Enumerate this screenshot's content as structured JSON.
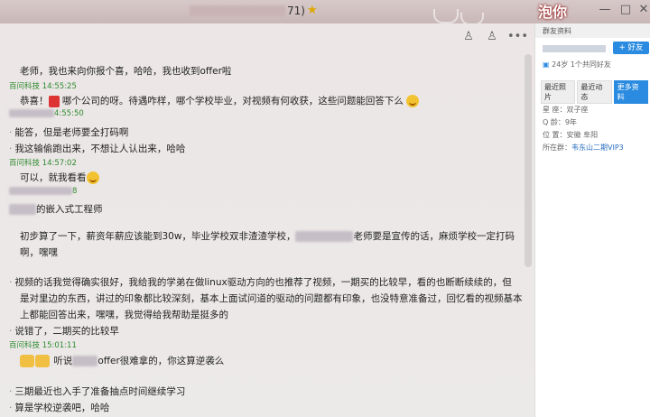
{
  "window": {
    "title_suffix": "71)",
    "logo_text": "泡你",
    "controls": [
      "—",
      "□",
      "✕"
    ]
  },
  "chat_header_icons": [
    "person-icon",
    "person-add-icon",
    "more-icon"
  ],
  "messages": [
    {
      "type": "text",
      "text": "老师，我也来向你报个喜，哈哈，我也收到offer啦"
    },
    {
      "type": "stamp",
      "text": "百问科技  14:55:25"
    },
    {
      "type": "text",
      "pre": "恭喜！",
      "post": "哪个公司的呀。待遇咋样，哪个学校毕业，对视频有何收获，这些问题能回答下么"
    },
    {
      "type": "stamp",
      "text": "4:55:50"
    },
    {
      "type": "bullet",
      "text": "能答，但是老师要全打码啊"
    },
    {
      "type": "bullet",
      "text": "我这输偷跑出来，不想让人认出来，哈哈"
    },
    {
      "type": "stamp",
      "text": "百问科技  14:57:02"
    },
    {
      "type": "text",
      "text": "可以，就我看看"
    },
    {
      "type": "stamp",
      "text": "8"
    },
    {
      "type": "text",
      "text": "的嵌入式工程师"
    },
    {
      "type": "text",
      "text": "初步算了一下，薪资年薪应该能到30w，毕业学校双非渣渣学校，",
      "tail": "老师要是宣传的话，麻烦学校一定打码"
    },
    {
      "type": "text",
      "text": "啊，嘿嘿"
    },
    {
      "type": "bullet",
      "text": "视频的话我觉得确实很好，我给我的学弟在做linux驱动方向的也推荐了视频，一期买的比较早，看的也断断续续的，但"
    },
    {
      "type": "text",
      "text": "是对里边的东西，讲过的印象都比较深刻，基本上面试问道的驱动的问题都有印象，也没特意准备过，回忆看的视频基本"
    },
    {
      "type": "text",
      "text": "上都能回答出来，嘿嘿，我觉得给我帮助是挺多的"
    },
    {
      "type": "bullet",
      "text": "说错了，二期买的比较早"
    },
    {
      "type": "stamp",
      "text": "百问科技  15:01:11"
    },
    {
      "type": "text",
      "pre": "听说",
      "text": "offer很难拿的，你这算逆袭么"
    },
    {
      "type": "bullet",
      "text": "三期最近也入手了准备抽点时间继续学习"
    },
    {
      "type": "bullet",
      "text": "算是学校逆袭吧，哈哈"
    }
  ],
  "panel": {
    "header": "群友资料",
    "add_friend": "+ 好友",
    "age_line": "24岁  1个共同好友",
    "tabs": [
      "最近照片",
      "最近动态",
      "更多资料"
    ],
    "details": [
      {
        "label": "星  座：",
        "value": "双子座"
      },
      {
        "label": "Q  龄：",
        "value": "9年"
      },
      {
        "label": "位  置：",
        "value": "安徽 阜阳"
      },
      {
        "label": "所在群：",
        "value": "韦东山二期VIP3"
      }
    ]
  }
}
